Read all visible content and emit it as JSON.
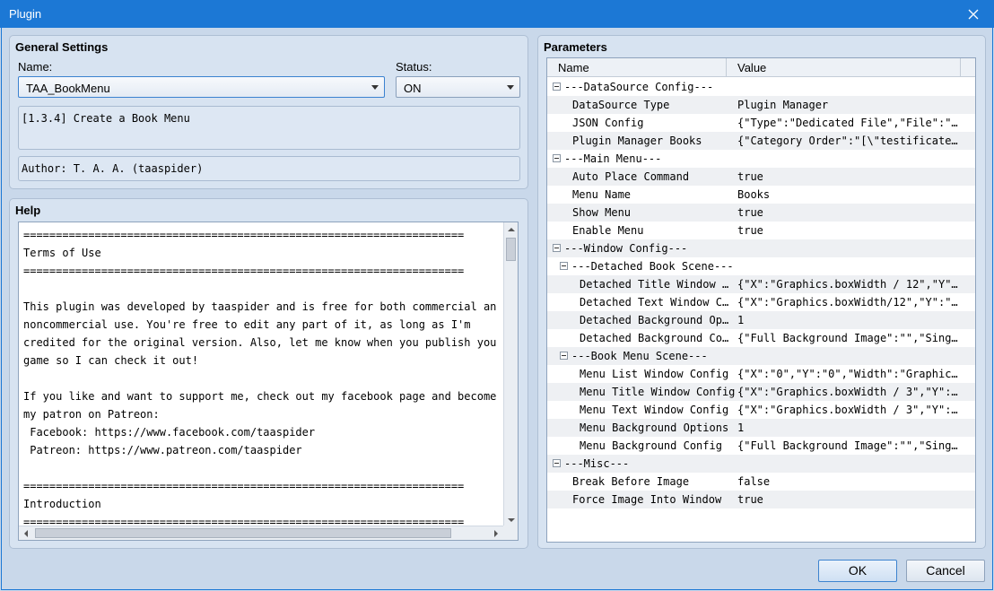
{
  "window": {
    "title": "Plugin"
  },
  "general": {
    "title": "General Settings",
    "name_label": "Name:",
    "name_value": "TAA_BookMenu",
    "status_label": "Status:",
    "status_value": "ON",
    "description": "[1.3.4] Create a Book Menu",
    "author": "Author: T. A. A. (taaspider)"
  },
  "help": {
    "title": "Help",
    "text": "====================================================================\nTerms of Use\n====================================================================\n\nThis plugin was developed by taaspider and is free for both commercial and\nnoncommercial use. You're free to edit any part of it, as long as I'm\ncredited for the original version. Also, let me know when you publish your\ngame so I can check it out!\n\nIf you like and want to support me, check out my facebook page and become\nmy patron on Patreon:\n Facebook: https://www.facebook.com/taaspider\n Patreon: https://www.patreon.com/taaspider\n\n====================================================================\nIntroduction\n===================================================================="
  },
  "parameters": {
    "title": "Parameters",
    "col_name": "Name",
    "col_value": "Value",
    "rows": [
      {
        "name": "---DataSource Config---",
        "value": "",
        "level": 0,
        "group": true
      },
      {
        "name": "DataSource Type",
        "value": "Plugin Manager",
        "level": 1,
        "group": false
      },
      {
        "name": "JSON Config",
        "value": "{\"Type\":\"Dedicated File\",\"File\":\"b…",
        "level": 1,
        "group": false
      },
      {
        "name": "Plugin Manager Books",
        "value": "{\"Category Order\":\"[\\\"testificate\\…",
        "level": 1,
        "group": false
      },
      {
        "name": "---Main Menu---",
        "value": "",
        "level": 0,
        "group": true
      },
      {
        "name": "Auto Place Command",
        "value": "true",
        "level": 1,
        "group": false
      },
      {
        "name": "Menu Name",
        "value": "Books",
        "level": 1,
        "group": false
      },
      {
        "name": "Show Menu",
        "value": "true",
        "level": 1,
        "group": false
      },
      {
        "name": "Enable Menu",
        "value": "true",
        "level": 1,
        "group": false
      },
      {
        "name": "---Window Config---",
        "value": "",
        "level": 0,
        "group": true
      },
      {
        "name": "---Detached Book Scene---",
        "value": "",
        "level": 1,
        "group": true
      },
      {
        "name": "Detached Title Window …",
        "value": "{\"X\":\"Graphics.boxWidth / 12\",\"Y\":…",
        "level": 2,
        "group": false
      },
      {
        "name": "Detached Text Window C…",
        "value": "{\"X\":\"Graphics.boxWidth/12\",\"Y\":\"0…",
        "level": 2,
        "group": false
      },
      {
        "name": "Detached Background Op…",
        "value": "1",
        "level": 2,
        "group": false
      },
      {
        "name": "Detached Background Co…",
        "value": "{\"Full Background Image\":\"\",\"Singl…",
        "level": 2,
        "group": false
      },
      {
        "name": "---Book Menu Scene---",
        "value": "",
        "level": 1,
        "group": true
      },
      {
        "name": "Menu List Window Config",
        "value": "{\"X\":\"0\",\"Y\":\"0\",\"Width\":\"Graphics…",
        "level": 2,
        "group": false
      },
      {
        "name": "Menu Title Window Config",
        "value": "{\"X\":\"Graphics.boxWidth / 3\",\"Y\":\"…",
        "level": 2,
        "group": false
      },
      {
        "name": "Menu Text Window Config",
        "value": "{\"X\":\"Graphics.boxWidth / 3\",\"Y\":\"…",
        "level": 2,
        "group": false
      },
      {
        "name": "Menu Background Options",
        "value": "1",
        "level": 2,
        "group": false
      },
      {
        "name": "Menu Background Config",
        "value": "{\"Full Background Image\":\"\",\"Singl…",
        "level": 2,
        "group": false
      },
      {
        "name": "---Misc---",
        "value": "",
        "level": 0,
        "group": true
      },
      {
        "name": "Break Before Image",
        "value": "false",
        "level": 1,
        "group": false
      },
      {
        "name": "Force Image Into Window",
        "value": "true",
        "level": 1,
        "group": false
      }
    ]
  },
  "buttons": {
    "ok": "OK",
    "cancel": "Cancel"
  },
  "colors": {
    "titlebar": "#1c78d5",
    "window_bg": "#c9d8ea",
    "panel_bg": "#d7e3f1"
  }
}
